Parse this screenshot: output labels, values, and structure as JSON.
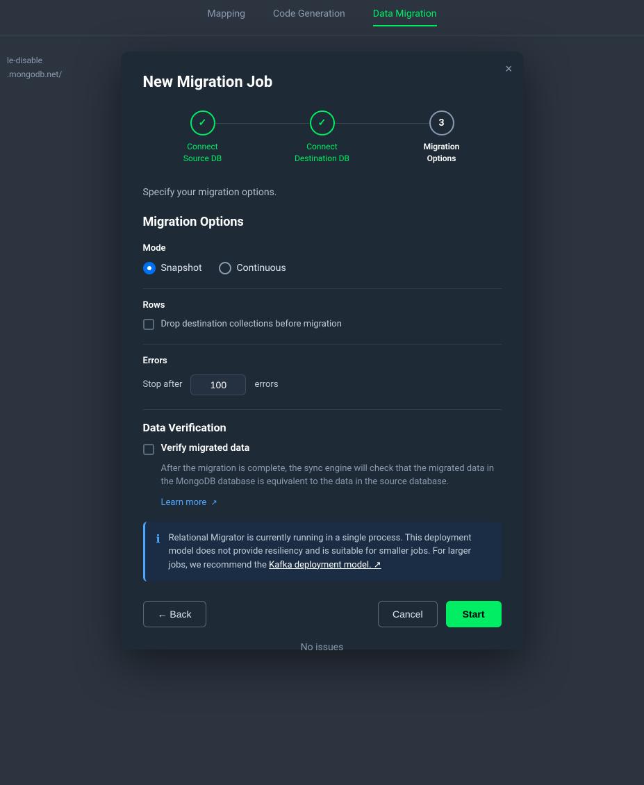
{
  "tabs": {
    "items": [
      {
        "id": "mapping",
        "label": "Mapping",
        "active": false
      },
      {
        "id": "code-generation",
        "label": "Code Generation",
        "active": false
      },
      {
        "id": "data-migration",
        "label": "Data Migration",
        "active": true
      }
    ]
  },
  "bg_sidebar": {
    "line1": "le-disable",
    "line2": ".mongodb.net/"
  },
  "modal": {
    "title": "New Migration Job",
    "close_label": "×",
    "subtitle": "Specify your migration options.",
    "steps": [
      {
        "id": "connect-source",
        "number": "✓",
        "label": "Connect\nSource DB",
        "state": "completed"
      },
      {
        "id": "connect-destination",
        "number": "✓",
        "label": "Connect\nDestination DB",
        "state": "completed"
      },
      {
        "id": "migration-options",
        "number": "3",
        "label": "Migration\nOptions",
        "state": "active"
      }
    ],
    "section_heading": "Migration Options",
    "mode": {
      "label": "Mode",
      "options": [
        {
          "id": "snapshot",
          "label": "Snapshot",
          "selected": true
        },
        {
          "id": "continuous",
          "label": "Continuous",
          "selected": false
        }
      ]
    },
    "rows": {
      "label": "Rows",
      "checkbox_label": "Drop destination collections before migration",
      "checked": false
    },
    "errors": {
      "label": "Errors",
      "stop_after_label": "Stop after",
      "value": "100",
      "suffix": "errors"
    },
    "data_verification": {
      "heading": "Data Verification",
      "checkbox_label": "Verify migrated data",
      "checked": false,
      "description": "After the migration is complete, the sync engine will check that the migrated data in the MongoDB database is equivalent to the data in the source database.",
      "learn_more_label": "Learn more",
      "learn_more_icon": "↗"
    },
    "info_banner": {
      "icon": "ℹ",
      "text_before": "Relational Migrator is currently running in a single process. This deployment model does not provide resiliency and is suitable for smaller jobs. For larger jobs, we recommend the ",
      "link_label": "Kafka deployment model.",
      "link_icon": "↗"
    },
    "footer": {
      "back_label": "← Back",
      "cancel_label": "Cancel",
      "start_label": "Start"
    }
  },
  "no_issues": "No issues"
}
